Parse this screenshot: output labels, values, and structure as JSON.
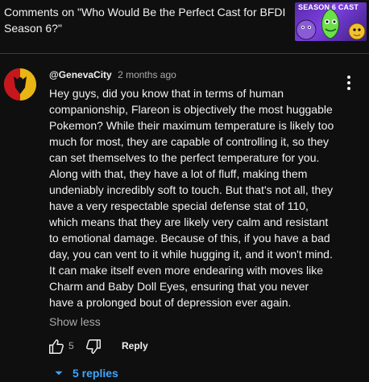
{
  "header": {
    "title": "Comments on \"Who Would Be the Perfect Cast for BFDI Season 6?\"",
    "thumbnail_text": "SEASON 6 CAST"
  },
  "comment": {
    "author": "@GenevaCity",
    "time": "2 months ago",
    "text": "Hey guys, did you know that in terms of human companionship, Flareon is objectively the most huggable Pokemon? While their maximum temperature is likely too much for most, they are capable of controlling it, so they can set themselves to the perfect temperature for you. Along with that, they have a lot of fluff, making them undeniably incredibly soft to touch. But that's not all, they have a very respectable special defense stat of 110, which means that they are likely very calm and resistant to emotional damage. Because of this, if you have a bad day, you can vent to it while hugging it, and it won't mind. It can make itself even more endearing with moves like Charm and Baby Doll Eyes, ensuring that you never have a prolonged bout of depression ever again.",
    "show_less": "Show less",
    "like_count": "5",
    "reply_label": "Reply",
    "replies_label": "5 replies"
  },
  "colors": {
    "background": "#0f0f0f",
    "text": "#f1f1f1",
    "secondary": "#aaaaaa",
    "link": "#3ea6ff"
  }
}
